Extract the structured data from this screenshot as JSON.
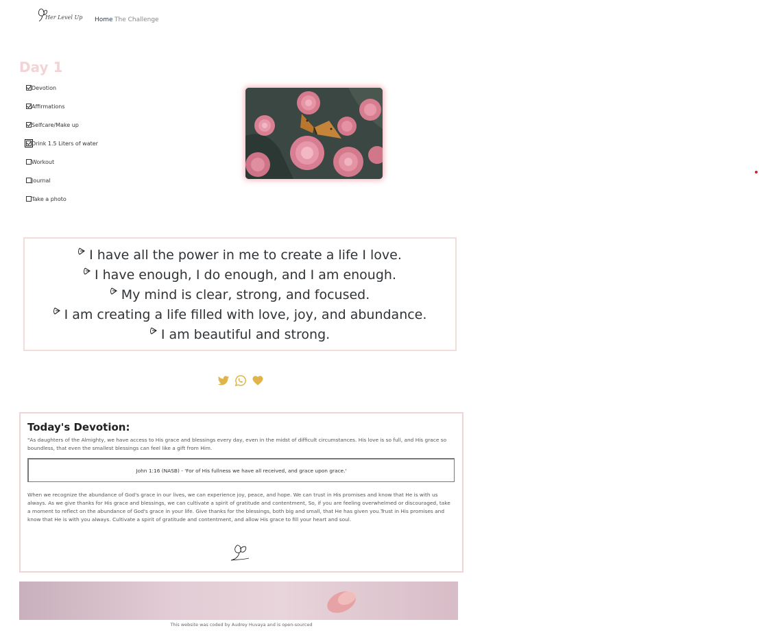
{
  "header": {
    "logo_text": "Her Level Up",
    "nav": [
      {
        "label": "Home"
      },
      {
        "label": "The Challenge"
      }
    ]
  },
  "day_title": "Day 1",
  "checklist": [
    {
      "label": "Devotion",
      "checked": true
    },
    {
      "label": "Affirmations",
      "checked": true
    },
    {
      "label": "Selfcare/Make up",
      "checked": true
    },
    {
      "label": "Drink 1.5 Liters of water",
      "checked": true,
      "focused": true
    },
    {
      "label": "Workout",
      "checked": false
    },
    {
      "label": "Journal",
      "checked": false
    },
    {
      "label": "Take a photo",
      "checked": false
    }
  ],
  "affirmations": [
    "I have all the power in me to create a life I love.",
    "I have enough, I do enough, and I am enough.",
    "My mind is clear, strong, and focused.",
    "I am creating a life filled with love, joy, and abundance.",
    "I am beautiful and strong."
  ],
  "share_icons": [
    "twitter-icon",
    "whatsapp-icon",
    "heart-icon"
  ],
  "devotion": {
    "title": "Today's Devotion:",
    "quote": "\"As daughters of the Almighty, we have access to His grace and blessings every day, even in the midst of difficult circumstances. His love is so full, and His grace so boundless, that even the smallest blessings can feel like a gift from Him.",
    "verse": "John 1:16 (NASB) - 'For of His fullness we have all received, and grace upon grace.'",
    "body": "When we recognize the abundance of God's grace in our lives, we can experience joy, peace, and hope. We can trust in His promises and know that He is with us always. As we give thanks for His grace and blessings, we can cultivate a spirit of gratitude and contentment, So, if you are feeling overwhelmed or discouraged, take a moment to reflect on the abundance of God's grace in your life. Give thanks for the blessings, both big and small, that He has given you.Trust in His promises and know that He is with you always. Cultivate a spirit of gratitude and contentment, and allow His grace to fill your heart and soul."
  },
  "footer": {
    "credit": "This website was coded by Audrey Huvaya and is open-sourced"
  },
  "colors": {
    "accent_pink": "#f3d4d6",
    "icon_gold": "#e0b44a",
    "status_dot": "#d0202a"
  }
}
